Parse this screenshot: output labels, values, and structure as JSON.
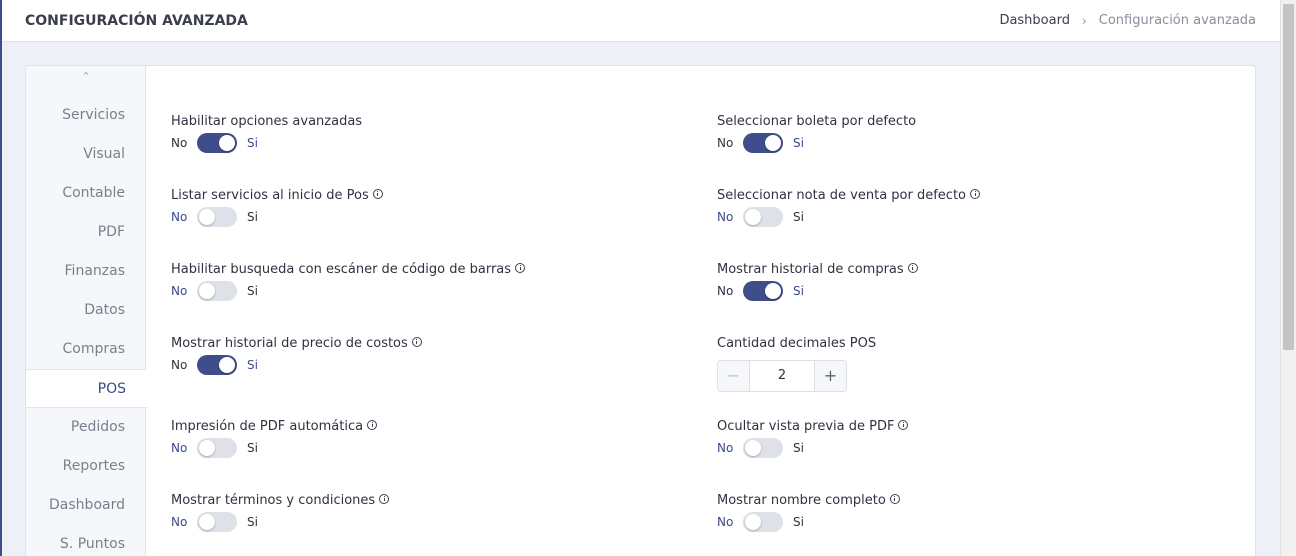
{
  "header": {
    "title": "CONFIGURACIÓN AVANZADA",
    "breadcrumb": {
      "home": "Dashboard",
      "separator": "›",
      "current": "Configuración avanzada"
    }
  },
  "sidebar": {
    "up_icon": "⌃",
    "items": [
      {
        "label": "Servicios"
      },
      {
        "label": "Visual"
      },
      {
        "label": "Contable"
      },
      {
        "label": "PDF"
      },
      {
        "label": "Finanzas"
      },
      {
        "label": "Datos"
      },
      {
        "label": "Compras"
      },
      {
        "label": "POS",
        "active": true
      },
      {
        "label": "Pedidos"
      },
      {
        "label": "Reportes"
      },
      {
        "label": "Dashboard"
      },
      {
        "label": "S. Puntos"
      }
    ]
  },
  "settings": {
    "no_label": "No",
    "si_label": "Si",
    "left": [
      {
        "label": "Habilitar opciones avanzadas",
        "info": false,
        "enabled": true
      },
      {
        "label": "Listar servicios al inicio de Pos",
        "info": true,
        "enabled": false
      },
      {
        "label": "Habilitar busqueda con escáner de código de barras",
        "info": true,
        "enabled": false
      },
      {
        "label": "Mostrar historial de precio de costos",
        "info": true,
        "enabled": true
      },
      {
        "label": "Impresión de PDF automática",
        "info": true,
        "enabled": false
      },
      {
        "label": "Mostrar términos y condiciones",
        "info": true,
        "enabled": false
      }
    ],
    "right": [
      {
        "label": "Seleccionar boleta por defecto",
        "info": false,
        "enabled": true
      },
      {
        "label": "Seleccionar nota de venta por defecto",
        "info": true,
        "enabled": false
      },
      {
        "label": "Mostrar historial de compras",
        "info": true,
        "enabled": true
      },
      {
        "label": "Cantidad decimales POS",
        "stepper": true,
        "value": "2",
        "minus": "−",
        "plus": "+"
      },
      {
        "label": "Ocultar vista previa de PDF",
        "info": true,
        "enabled": false
      },
      {
        "label": "Mostrar nombre completo",
        "info": true,
        "enabled": false
      }
    ]
  },
  "colors": {
    "accent": "#3f4d8a",
    "toggle_off": "#dfe1e8"
  }
}
